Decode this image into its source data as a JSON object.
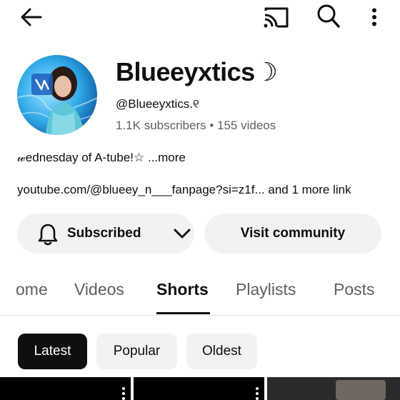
{
  "topbar": {
    "back_icon": "arrow-left-icon",
    "cast_icon": "cast-icon",
    "search_icon": "search-icon",
    "more_icon": "more-vertical-icon"
  },
  "channel": {
    "name": "Blueeyxtics☽",
    "handle": "@Blueeyxtics.୧",
    "subscribers": "1.1K subscribers",
    "separator": " • ",
    "videos": "155 videos",
    "description": "𝓌ednesday of A-tube!☆",
    "description_more": " ...more",
    "link_text": "youtube.com/@blueey_n___fanpage?si=z1f...",
    "link_more": " and 1 more link"
  },
  "actions": {
    "subscribe_label": "Subscribed",
    "community_label": "Visit community"
  },
  "tabs": [
    {
      "label": "ome"
    },
    {
      "label": "Videos"
    },
    {
      "label": "Shorts"
    },
    {
      "label": "Playlists"
    },
    {
      "label": "Posts"
    }
  ],
  "active_tab": "Shorts",
  "filters": [
    {
      "label": "Latest"
    },
    {
      "label": "Popular"
    },
    {
      "label": "Oldest"
    }
  ],
  "active_filter": "Latest",
  "colors": {
    "text_primary": "#0f0f0f",
    "text_secondary": "#606060",
    "pill_bg": "#f2f2f2",
    "active_chip_bg": "#0f0f0f"
  }
}
